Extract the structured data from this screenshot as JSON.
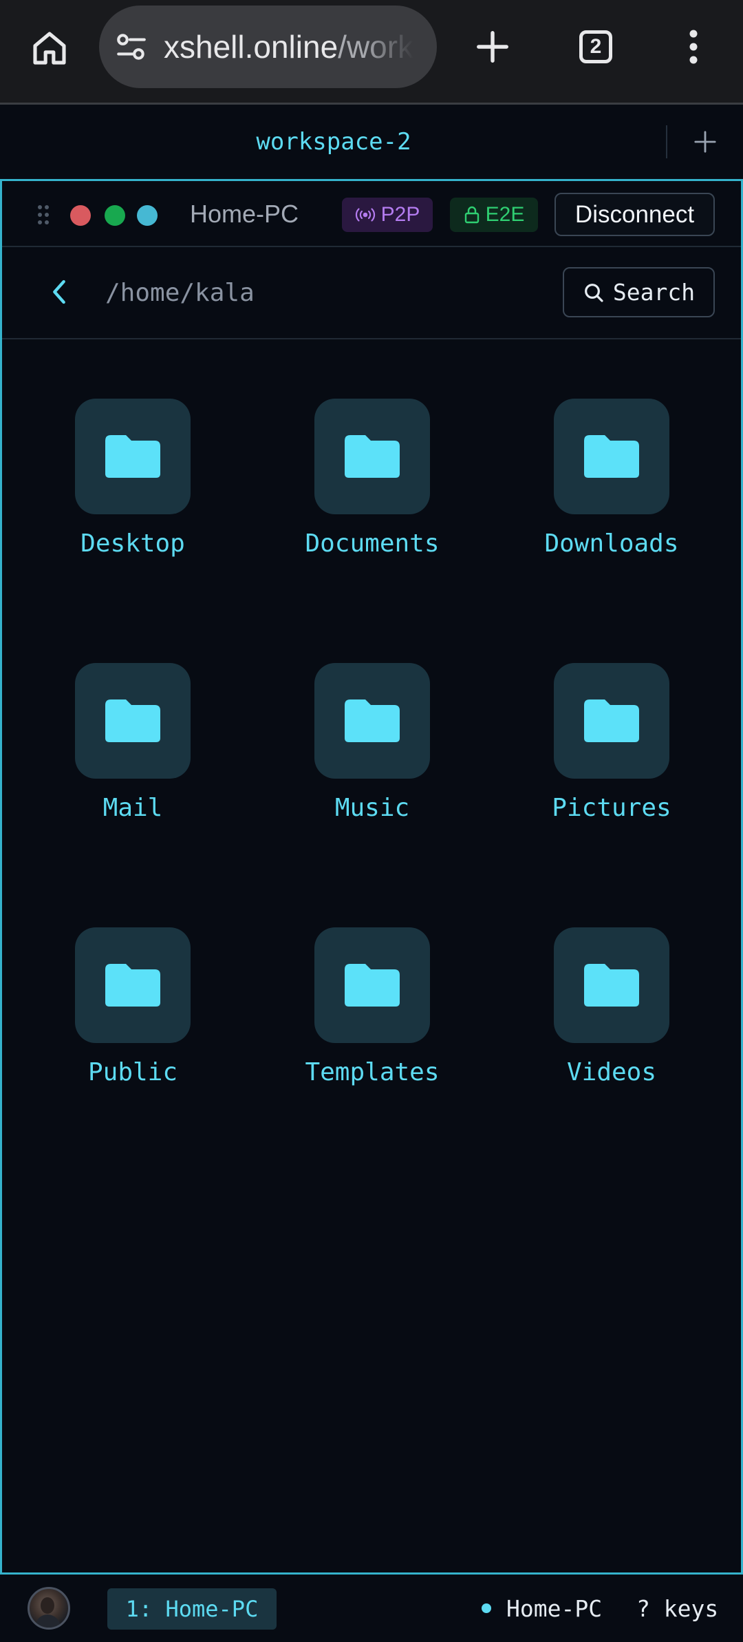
{
  "browser": {
    "url_host": "xshell.online",
    "url_path": "/work",
    "tab_count": "2"
  },
  "workspace": {
    "tab_label": "workspace-2",
    "add_symbol": "+"
  },
  "connection": {
    "host": "Home-PC",
    "p2p_label": "P2P",
    "e2e_label": "E2E",
    "disconnect_label": "Disconnect"
  },
  "files": {
    "path": "/home/kala",
    "search_label": "Search",
    "folders": [
      {
        "name": "Desktop"
      },
      {
        "name": "Documents"
      },
      {
        "name": "Downloads"
      },
      {
        "name": "Mail"
      },
      {
        "name": "Music"
      },
      {
        "name": "Pictures"
      },
      {
        "name": "Public"
      },
      {
        "name": "Templates"
      },
      {
        "name": "Videos"
      }
    ]
  },
  "status": {
    "session_chip": "1: Home-PC",
    "host": "Home-PC",
    "keys_hint": "? keys"
  },
  "colors": {
    "accent": "#5ddbf2",
    "background": "#070b13",
    "folder_tile": "#1a3440",
    "p2p": "#b47cf0",
    "e2e": "#2fcf72"
  }
}
